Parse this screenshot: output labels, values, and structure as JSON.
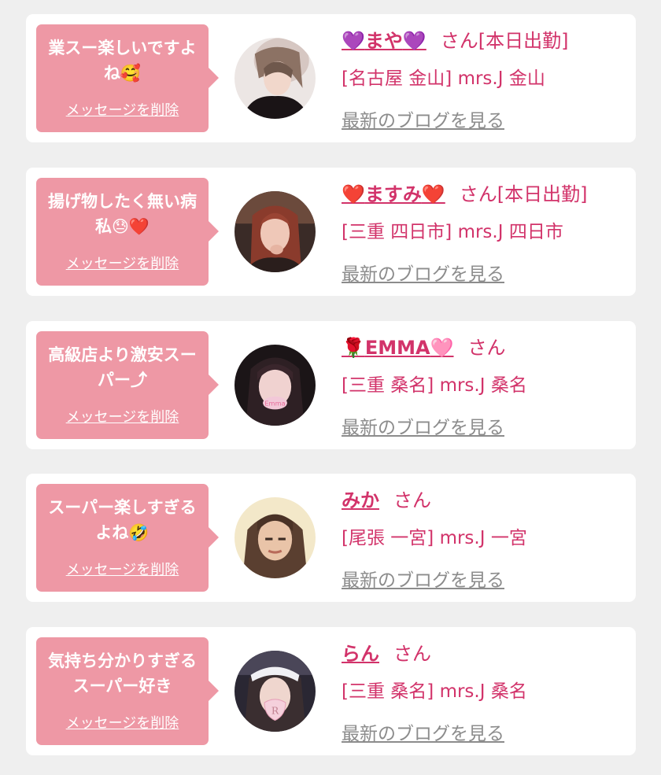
{
  "colors": {
    "page_bg": "#efefef",
    "card_bg": "#ffffff",
    "bubble_bg": "#ee98a5",
    "accent": "#d2336a",
    "link_gray": "#8c8c8c"
  },
  "cards": [
    {
      "message": "業スー楽しいですよね🥰",
      "delete_label": "メッセージを削除",
      "name_prefix": "💜",
      "name": "まや",
      "name_suffix": "💜",
      "honorific": "さん[本日出勤]",
      "location": "[名古屋 金山] mrs.J 金山",
      "blog_label": "最新のブログを見る",
      "avatar_icon": "woman-avatar-photo"
    },
    {
      "message": "揚げ物したく無い病私😓❤️",
      "delete_label": "メッセージを削除",
      "name_prefix": "❤️",
      "name": "ますみ",
      "name_suffix": "❤️",
      "honorific": "さん[本日出勤]",
      "location": "[三重 四日市] mrs.J 四日市",
      "blog_label": "最新のブログを見る",
      "avatar_icon": "woman-avatar-photo"
    },
    {
      "message": "高級店より激安スーパー⤴",
      "delete_label": "メッセージを削除",
      "name_prefix": "🌹",
      "name": "EMMA",
      "name_suffix": "🩷",
      "honorific": "さん",
      "location": "[三重 桑名] mrs.J 桑名",
      "blog_label": "最新のブログを見る",
      "avatar_icon": "woman-avatar-photo",
      "avatar_caption": "Emma"
    },
    {
      "message": "スーパー楽しすぎるよね🤣",
      "delete_label": "メッセージを削除",
      "name_prefix": "",
      "name": "みか",
      "name_suffix": "",
      "honorific": "さん",
      "location": "[尾張 一宮] mrs.J 一宮",
      "blog_label": "最新のブログを見る",
      "avatar_icon": "woman-avatar-photo"
    },
    {
      "message": "気持ち分かりすぎるスーパー好き",
      "delete_label": "メッセージを削除",
      "name_prefix": "",
      "name": "らん",
      "name_suffix": "",
      "honorific": "さん",
      "location": "[三重 桑名] mrs.J 桑名",
      "blog_label": "最新のブログを見る",
      "avatar_icon": "woman-avatar-photo",
      "avatar_caption": "R"
    }
  ]
}
